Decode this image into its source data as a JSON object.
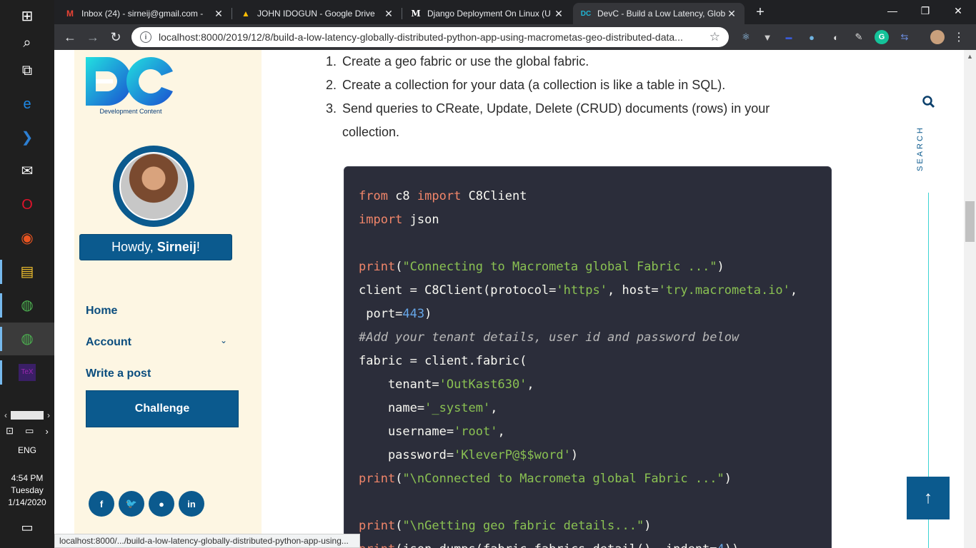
{
  "taskbar": {
    "icons": [
      {
        "name": "windows-start-icon",
        "glyph": "⊞"
      },
      {
        "name": "search-icon",
        "glyph": "⌕"
      },
      {
        "name": "task-view-icon",
        "glyph": "⧉"
      },
      {
        "name": "edge-icon",
        "glyph": "e"
      },
      {
        "name": "powershell-icon",
        "glyph": "❯"
      },
      {
        "name": "mail-icon",
        "glyph": "✉"
      },
      {
        "name": "opera-icon",
        "glyph": "O"
      },
      {
        "name": "ubuntu-icon",
        "glyph": "◉"
      },
      {
        "name": "file-explorer-icon",
        "glyph": "▤"
      },
      {
        "name": "chrome-icon",
        "glyph": "◍"
      },
      {
        "name": "chrome-profile-icon",
        "glyph": "◍"
      },
      {
        "name": "texstudio-icon",
        "glyph": "TeX"
      }
    ],
    "language": "ENG",
    "time": "4:54 PM",
    "day": "Tuesday",
    "date": "1/14/2020"
  },
  "browser": {
    "tabs": [
      {
        "title": "Inbox (24) - sirneij@gmail.com - ",
        "favicon": "M",
        "favicon_color": "#ea4335"
      },
      {
        "title": "JOHN IDOGUN - Google Drive",
        "favicon": "▲",
        "favicon_color": "#fbbc04"
      },
      {
        "title": "Django Deployment On Linux (U",
        "favicon": "M",
        "favicon_color": "#ffffff"
      },
      {
        "title": "DevC - Build a Low Latency, Glob",
        "favicon": "DC",
        "favicon_color": "#1fb6d6"
      }
    ],
    "url": "localhost:8000/2019/12/8/build-a-low-latency-globally-distributed-python-app-using-macrometas-geo-distributed-data...",
    "status_url": "localhost:8000/.../build-a-low-latency-globally-distributed-python-app-using..."
  },
  "sidebar": {
    "logo_caption": "Development Content",
    "howdy_prefix": "Howdy,",
    "howdy_name": "Sirneij",
    "howdy_suffix": "!",
    "nav": {
      "home": "Home",
      "account": "Account",
      "write": "Write a post",
      "challenge": "Challenge"
    },
    "social": [
      "f",
      "t",
      "gh",
      "in"
    ]
  },
  "article": {
    "steps": [
      {
        "num": "1.",
        "text": "Create a geo fabric or use the global fabric."
      },
      {
        "num": "2.",
        "text": "Create a collection for your data (a collection is like a table in SQL)."
      },
      {
        "num": "3.",
        "text": "Send queries to CReate, Update, Delete (CRUD) documents (rows) in your collection."
      }
    ],
    "code_lines": [
      [
        {
          "t": "kw",
          "v": "from"
        },
        {
          "t": "",
          "v": " c8 "
        },
        {
          "t": "kw",
          "v": "import"
        },
        {
          "t": "",
          "v": " C8Client"
        }
      ],
      [
        {
          "t": "kw",
          "v": "import"
        },
        {
          "t": "",
          "v": " json"
        }
      ],
      [],
      [
        {
          "t": "fn",
          "v": "print"
        },
        {
          "t": "",
          "v": "("
        },
        {
          "t": "str",
          "v": "\"Connecting to Macrometa global Fabric ...\""
        },
        {
          "t": "",
          "v": ")"
        }
      ],
      [
        {
          "t": "",
          "v": "client = C8Client(protocol="
        },
        {
          "t": "str",
          "v": "'https'"
        },
        {
          "t": "",
          "v": ", host="
        },
        {
          "t": "str",
          "v": "'try.macrometa.io'"
        },
        {
          "t": "",
          "v": ","
        }
      ],
      [
        {
          "t": "",
          "v": " port="
        },
        {
          "t": "num",
          "v": "443"
        },
        {
          "t": "",
          "v": ")"
        }
      ],
      [
        {
          "t": "cm",
          "v": "#Add your tenant details, user id and password below"
        }
      ],
      [
        {
          "t": "",
          "v": "fabric = client.fabric("
        }
      ],
      [
        {
          "t": "",
          "v": "    tenant="
        },
        {
          "t": "str",
          "v": "'OutKast630'"
        },
        {
          "t": "",
          "v": ","
        }
      ],
      [
        {
          "t": "",
          "v": "    name="
        },
        {
          "t": "str",
          "v": "'_system'"
        },
        {
          "t": "",
          "v": ","
        }
      ],
      [
        {
          "t": "",
          "v": "    username="
        },
        {
          "t": "str",
          "v": "'root'"
        },
        {
          "t": "",
          "v": ","
        }
      ],
      [
        {
          "t": "",
          "v": "    password="
        },
        {
          "t": "str",
          "v": "'KleverP@$$word'"
        },
        {
          "t": "",
          "v": ")"
        }
      ],
      [
        {
          "t": "fn",
          "v": "print"
        },
        {
          "t": "",
          "v": "("
        },
        {
          "t": "str",
          "v": "\"\\nConnected to Macrometa global Fabric ...\""
        },
        {
          "t": "",
          "v": ")"
        }
      ],
      [],
      [
        {
          "t": "fn",
          "v": "print"
        },
        {
          "t": "",
          "v": "("
        },
        {
          "t": "str",
          "v": "\"\\nGetting geo fabric details...\""
        },
        {
          "t": "",
          "v": ")"
        }
      ],
      [
        {
          "t": "fn",
          "v": "print"
        },
        {
          "t": "",
          "v": "(json.dumps(fabric.fabrics_detail(), indent="
        },
        {
          "t": "num",
          "v": "4"
        },
        {
          "t": "",
          "v": "))"
        }
      ]
    ]
  },
  "search": {
    "label": "SEARCH"
  }
}
